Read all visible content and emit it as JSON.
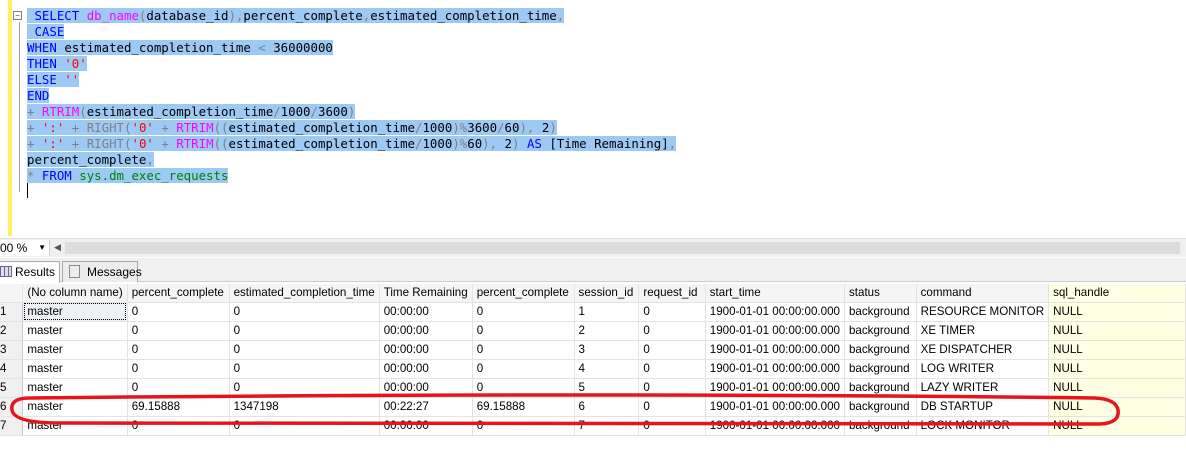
{
  "editor": {
    "lines": [
      [
        {
          "t": " SELECT ",
          "c": "kw"
        },
        {
          "t": "db_name",
          "c": "fn"
        },
        {
          "t": "(",
          "c": "op"
        },
        {
          "t": "database_id",
          "c": "id"
        },
        {
          "t": "),",
          "c": "op"
        },
        {
          "t": "percent_complete",
          "c": "id"
        },
        {
          "t": ",",
          "c": "op"
        },
        {
          "t": "estimated_completion_time",
          "c": "id"
        },
        {
          "t": ",",
          "c": "op"
        }
      ],
      [
        {
          "t": " CASE",
          "c": "kw"
        }
      ],
      [
        {
          "t": "WHEN ",
          "c": "kw"
        },
        {
          "t": "estimated_completion_time ",
          "c": "id"
        },
        {
          "t": "< ",
          "c": "op"
        },
        {
          "t": "36000000",
          "c": "id"
        }
      ],
      [
        {
          "t": "THEN ",
          "c": "kw"
        },
        {
          "t": "'0'",
          "c": "str"
        }
      ],
      [
        {
          "t": "ELSE ",
          "c": "kw"
        },
        {
          "t": "''",
          "c": "str"
        }
      ],
      [
        {
          "t": "END",
          "c": "kw"
        }
      ],
      [
        {
          "t": "+ ",
          "c": "op"
        },
        {
          "t": "RTRIM",
          "c": "fn"
        },
        {
          "t": "(",
          "c": "op"
        },
        {
          "t": "estimated_completion_time",
          "c": "id"
        },
        {
          "t": "/",
          "c": "op"
        },
        {
          "t": "1000",
          "c": "id"
        },
        {
          "t": "/",
          "c": "op"
        },
        {
          "t": "3600",
          "c": "id"
        },
        {
          "t": ")",
          "c": "op"
        }
      ],
      [
        {
          "t": "+ ",
          "c": "op"
        },
        {
          "t": "':'",
          "c": "str"
        },
        {
          "t": " + ",
          "c": "op"
        },
        {
          "t": "RIGHT",
          "c": "op"
        },
        {
          "t": "(",
          "c": "op"
        },
        {
          "t": "'0'",
          "c": "str"
        },
        {
          "t": " + ",
          "c": "op"
        },
        {
          "t": "RTRIM",
          "c": "fn"
        },
        {
          "t": "((",
          "c": "op"
        },
        {
          "t": "estimated_completion_time",
          "c": "id"
        },
        {
          "t": "/",
          "c": "op"
        },
        {
          "t": "1000",
          "c": "id"
        },
        {
          "t": ")%",
          "c": "op"
        },
        {
          "t": "3600",
          "c": "id"
        },
        {
          "t": "/",
          "c": "op"
        },
        {
          "t": "60",
          "c": "id"
        },
        {
          "t": "), ",
          "c": "op"
        },
        {
          "t": "2",
          "c": "id"
        },
        {
          "t": ")",
          "c": "op"
        }
      ],
      [
        {
          "t": "+ ",
          "c": "op"
        },
        {
          "t": "':'",
          "c": "str"
        },
        {
          "t": " + ",
          "c": "op"
        },
        {
          "t": "RIGHT",
          "c": "op"
        },
        {
          "t": "(",
          "c": "op"
        },
        {
          "t": "'0'",
          "c": "str"
        },
        {
          "t": " + ",
          "c": "op"
        },
        {
          "t": "RTRIM",
          "c": "fn"
        },
        {
          "t": "((",
          "c": "op"
        },
        {
          "t": "estimated_completion_time",
          "c": "id"
        },
        {
          "t": "/",
          "c": "op"
        },
        {
          "t": "1000",
          "c": "id"
        },
        {
          "t": ")%",
          "c": "op"
        },
        {
          "t": "60",
          "c": "id"
        },
        {
          "t": "), ",
          "c": "op"
        },
        {
          "t": "2",
          "c": "id"
        },
        {
          "t": ") ",
          "c": "op"
        },
        {
          "t": "AS ",
          "c": "kw"
        },
        {
          "t": "[Time Remaining]",
          "c": "id"
        },
        {
          "t": ",",
          "c": "op"
        }
      ],
      [
        {
          "t": "percent_complete",
          "c": "id"
        },
        {
          "t": ",",
          "c": "op"
        }
      ],
      [
        {
          "t": "* ",
          "c": "op"
        },
        {
          "t": "FROM ",
          "c": "kw"
        },
        {
          "t": "sys.dm_exec_requests",
          "c": "sys"
        }
      ]
    ]
  },
  "toolbar": {
    "zoom": "00 %"
  },
  "tabs": {
    "results": "Results",
    "messages": "Messages"
  },
  "grid": {
    "columns": [
      "(No column name)",
      "percent_complete",
      "estimated_completion_time",
      "Time Remaining",
      "percent_complete",
      "session_id",
      "request_id",
      "start_time",
      "status",
      "command",
      "sql_handle"
    ],
    "rows": [
      [
        "1",
        "master",
        "0",
        "0",
        "00:00:00",
        "0",
        "1",
        "0",
        "1900-01-01 00:00:00.000",
        "background",
        "RESOURCE MONITOR",
        "NULL"
      ],
      [
        "2",
        "master",
        "0",
        "0",
        "00:00:00",
        "0",
        "2",
        "0",
        "1900-01-01 00:00:00.000",
        "background",
        "XE TIMER",
        "NULL"
      ],
      [
        "3",
        "master",
        "0",
        "0",
        "00:00:00",
        "0",
        "3",
        "0",
        "1900-01-01 00:00:00.000",
        "background",
        "XE DISPATCHER",
        "NULL"
      ],
      [
        "4",
        "master",
        "0",
        "0",
        "00:00:00",
        "0",
        "4",
        "0",
        "1900-01-01 00:00:00.000",
        "background",
        "LOG WRITER",
        "NULL"
      ],
      [
        "5",
        "master",
        "0",
        "0",
        "00:00:00",
        "0",
        "5",
        "0",
        "1900-01-01 00:00:00.000",
        "background",
        "LAZY WRITER",
        "NULL"
      ],
      [
        "6",
        "master",
        "69.15888",
        "1347198",
        "00:22:27",
        "69.15888",
        "6",
        "0",
        "1900-01-01 00:00:00.000",
        "background",
        "DB STARTUP",
        "NULL"
      ],
      [
        "7",
        "master",
        "0",
        "0",
        "00:00:00",
        "0",
        "7",
        "0",
        "1900-01-01 00:00:00.000",
        "background",
        "LOCK MONITOR",
        "NULL"
      ]
    ],
    "highlighted_row": 6,
    "annotation_color": "#e8141c"
  }
}
